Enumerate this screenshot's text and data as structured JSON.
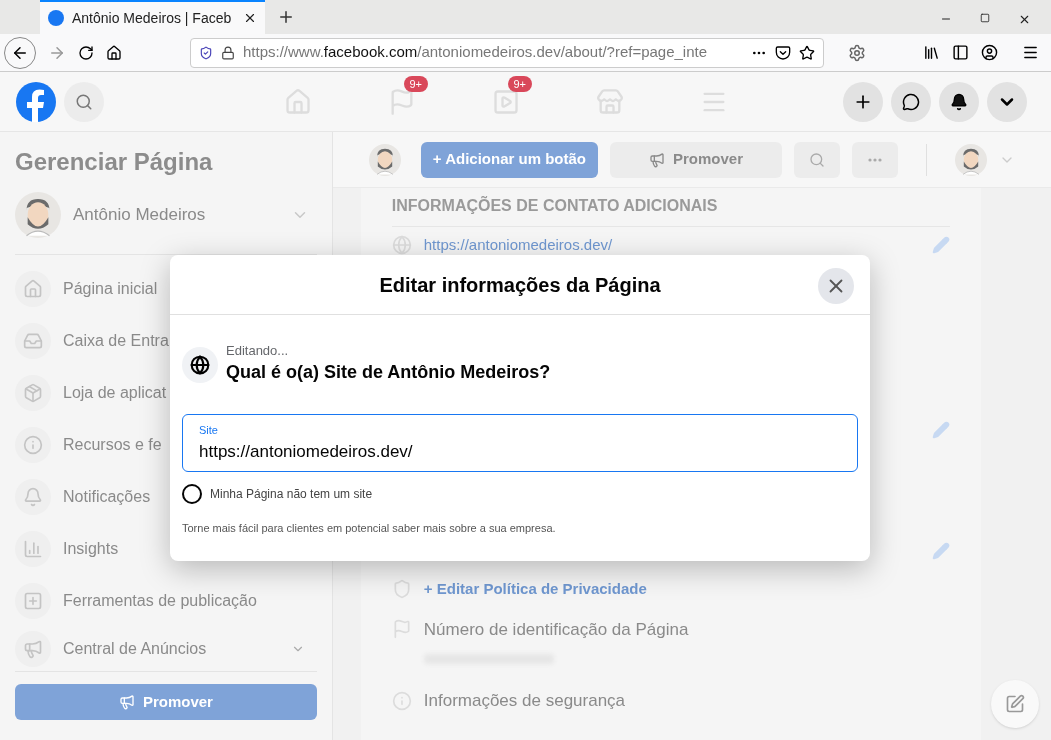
{
  "browser": {
    "tab_title": "Antônio Medeiros | Faceb",
    "url_prefix": "https://www.",
    "url_domain": "facebook.com",
    "url_path": "/antoniomedeiros.dev/about/?ref=page_inte"
  },
  "topbar": {
    "badges": [
      {
        "kind": "pages",
        "badge": "9+"
      },
      {
        "kind": "watch",
        "badge": "9+"
      }
    ]
  },
  "sidebar": {
    "title": "Gerenciar Página",
    "page_name": "Antônio Medeiros",
    "items": [
      {
        "kind": "home",
        "label": "Página inicial"
      },
      {
        "kind": "inbox",
        "label": "Caixa de Entra"
      },
      {
        "kind": "box",
        "label": "Loja de aplicat"
      },
      {
        "kind": "info",
        "label": "Recursos e fe"
      },
      {
        "kind": "bell",
        "label": "Notificações"
      },
      {
        "kind": "chart",
        "label": "Insights"
      },
      {
        "kind": "tools",
        "label": "Ferramentas de publicação"
      },
      {
        "kind": "megaphone",
        "label": "Central de Anúncios"
      }
    ],
    "promote_button": "Promover"
  },
  "page_header": {
    "add_button": "+ Adicionar um botão",
    "promote_button": "Promover"
  },
  "about": {
    "section_title": "INFORMAÇÕES DE CONTATO ADICIONAIS",
    "website": "https://antoniomedeiros.dev/",
    "privacy_link": "+ Editar Política de Privacidade",
    "page_id_label": "Número de identificação da Página",
    "security_label": "Informações de segurança"
  },
  "dialog": {
    "title": "Editar informações da Página",
    "editing_label": "Editando...",
    "question": "Qual é o(a) Site de Antônio Medeiros?",
    "field_label": "Site",
    "field_value": "https://antoniomedeiros.dev/",
    "no_site_option": {
      "label": "Minha Página não tem um site",
      "checked": false
    },
    "hint": "Torne mais fácil para clientes em potencial saber mais sobre a sua empresa."
  }
}
